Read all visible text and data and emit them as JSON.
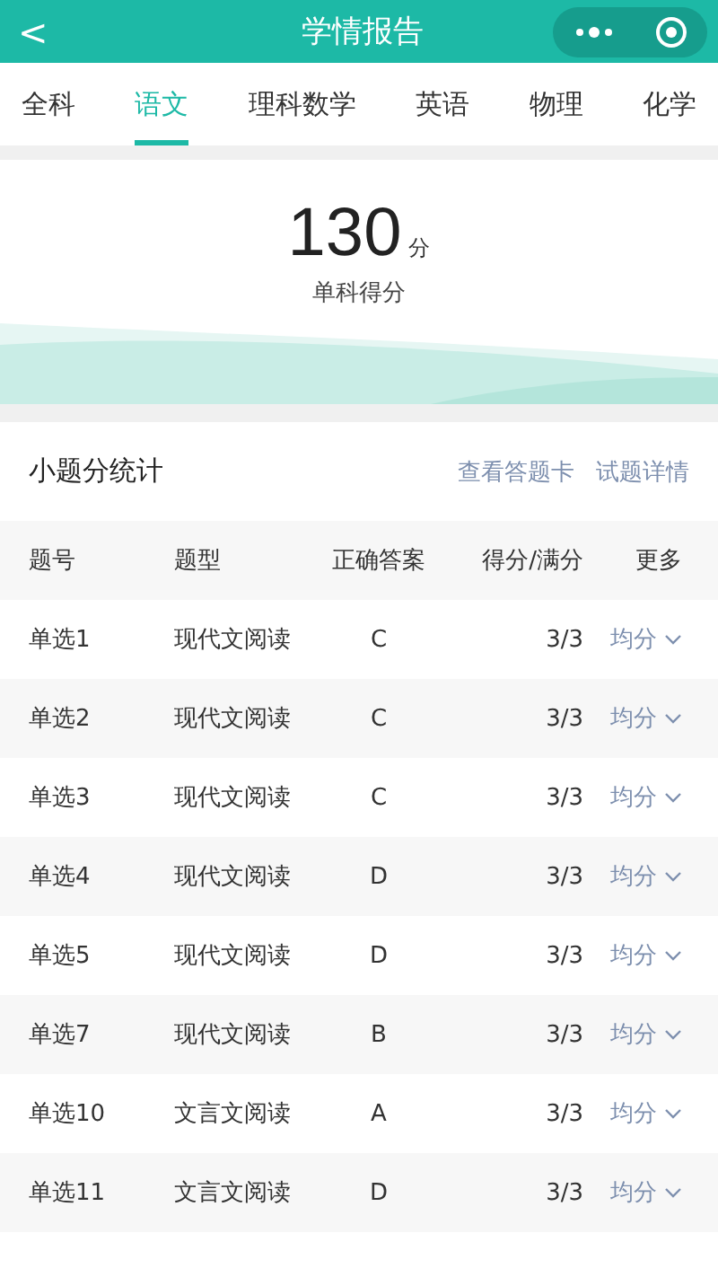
{
  "nav_bar": {
    "title": "学情报告",
    "back": "<"
  },
  "tabs": [
    {
      "label": "全科",
      "selected": false
    },
    {
      "label": "语文",
      "selected": true
    },
    {
      "label": "理科数学",
      "selected": false
    },
    {
      "label": "英语",
      "selected": false
    },
    {
      "label": "物理",
      "selected": false
    },
    {
      "label": "化学",
      "selected": false
    }
  ],
  "score": {
    "value": "130",
    "unit": "分",
    "caption": "单科得分"
  },
  "section": {
    "title": "小题分统计",
    "links": [
      "查看答题卡",
      "试题详情"
    ]
  },
  "table": {
    "columns": [
      "题号",
      "题型",
      "正确答案",
      "得分/满分",
      "更多"
    ],
    "rows": [
      {
        "number": "单选1",
        "type": "现代文阅读",
        "answer": "C",
        "score": "3/3",
        "more": "均分"
      },
      {
        "number": "单选2",
        "type": "现代文阅读",
        "answer": "C",
        "score": "3/3",
        "more": "均分"
      },
      {
        "number": "单选3",
        "type": "现代文阅读",
        "answer": "C",
        "score": "3/3",
        "more": "均分"
      },
      {
        "number": "单选4",
        "type": "现代文阅读",
        "answer": "D",
        "score": "3/3",
        "more": "均分"
      },
      {
        "number": "单选5",
        "type": "现代文阅读",
        "answer": "D",
        "score": "3/3",
        "more": "均分"
      },
      {
        "number": "单选7",
        "type": "现代文阅读",
        "answer": "B",
        "score": "3/3",
        "more": "均分"
      },
      {
        "number": "单选10",
        "type": "文言文阅读",
        "answer": "A",
        "score": "3/3",
        "more": "均分"
      },
      {
        "number": "单选11",
        "type": "文言文阅读",
        "answer": "D",
        "score": "3/3",
        "more": "均分"
      }
    ]
  }
}
